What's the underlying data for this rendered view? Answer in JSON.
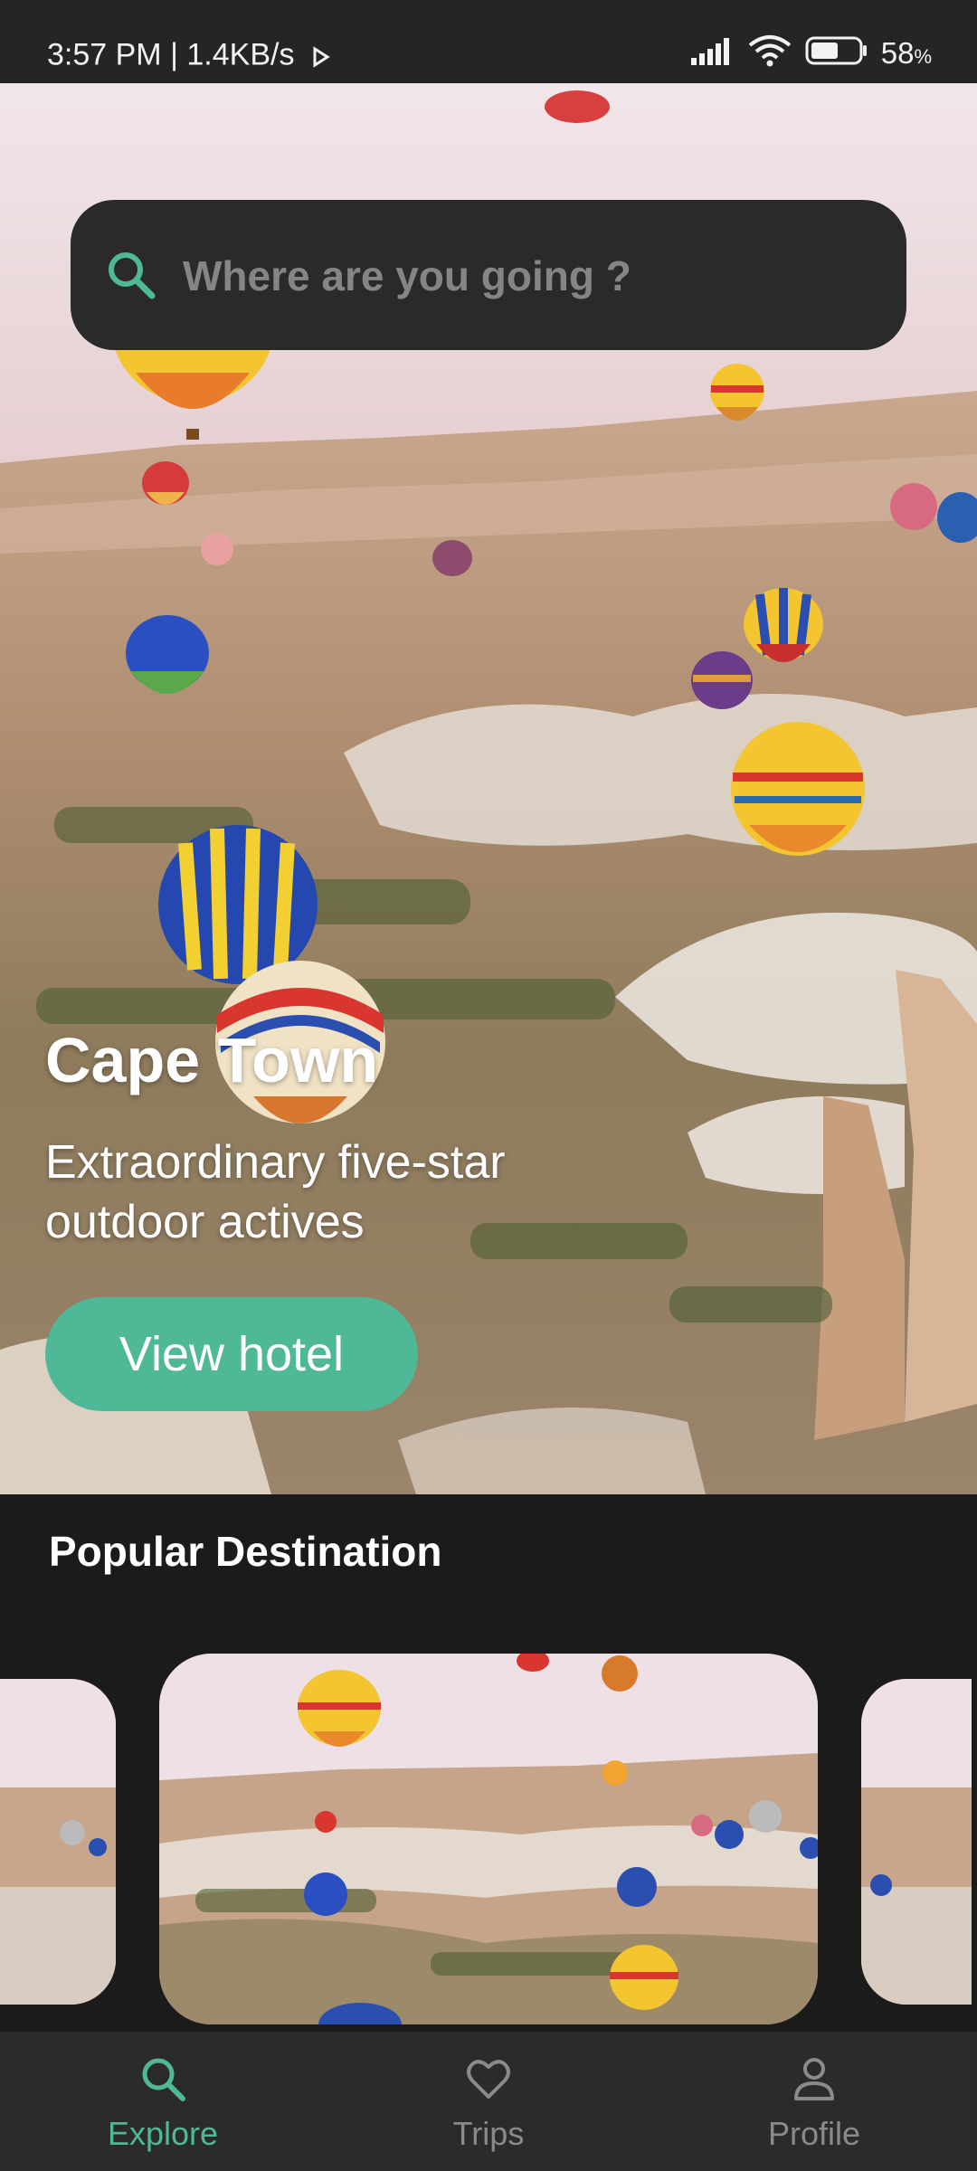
{
  "status_bar": {
    "time": "3:57 PM",
    "separator": "|",
    "speed": "1.4KB/s",
    "battery_percent": "58",
    "battery_unit": "%",
    "battery_level": 0.58
  },
  "search": {
    "placeholder": "Where are you going ?"
  },
  "hero": {
    "title": "Cape Town",
    "subtitle": "Extraordinary five-star outdoor actives",
    "button_label": "View hotel"
  },
  "popular": {
    "title": "Popular Destination"
  },
  "bottom_nav": {
    "items": [
      {
        "label": "Explore",
        "icon": "search-icon",
        "active": true
      },
      {
        "label": "Trips",
        "icon": "heart-icon",
        "active": false
      },
      {
        "label": "Profile",
        "icon": "person-icon",
        "active": false
      }
    ]
  },
  "colors": {
    "accent": "#4fb896",
    "background": "#1b1b1b",
    "search_bg": "#2a2a2a",
    "nav_bg": "#2b2b2b"
  }
}
